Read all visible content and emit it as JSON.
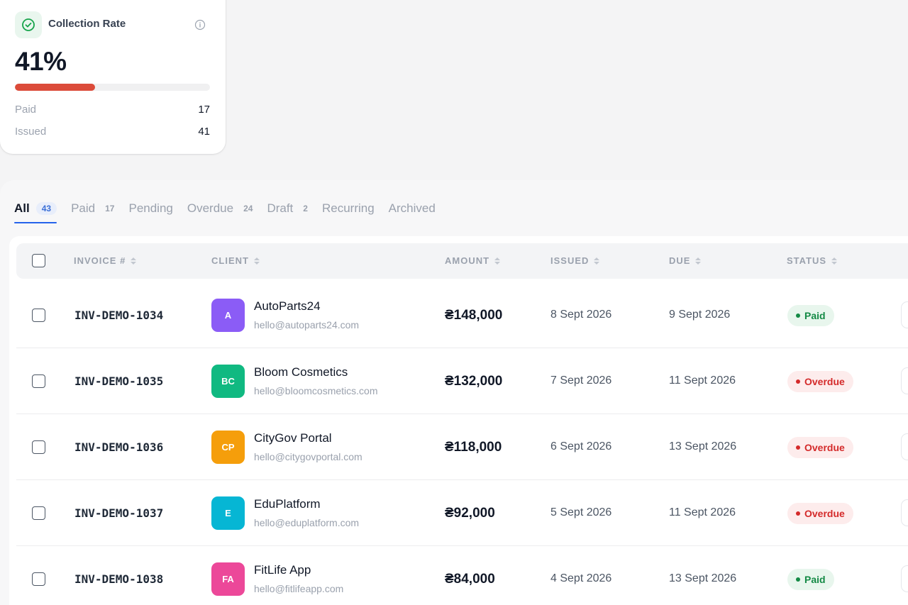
{
  "stat_card": {
    "title": "Collection Rate",
    "value": "41%",
    "progress_percent": 41,
    "rows": [
      {
        "label": "Paid",
        "value": "17"
      },
      {
        "label": "Issued",
        "value": "41"
      }
    ],
    "accent_color": "#dc4b3a"
  },
  "tabs": [
    {
      "label": "All",
      "count": "43",
      "active": true
    },
    {
      "label": "Paid",
      "count": "17"
    },
    {
      "label": "Pending",
      "count": ""
    },
    {
      "label": "Overdue",
      "count": "24"
    },
    {
      "label": "Draft",
      "count": "2"
    },
    {
      "label": "Recurring",
      "count": ""
    },
    {
      "label": "Archived",
      "count": ""
    }
  ],
  "table": {
    "headers": {
      "invoice": "INVOICE #",
      "client": "CLIENT",
      "amount": "AMOUNT",
      "issued": "ISSUED",
      "due": "DUE",
      "status": "STATUS"
    },
    "rows": [
      {
        "invoice": "INV-DEMO-1034",
        "initials": "A",
        "avatar_color": "#8b5cf6",
        "client": "AutoParts24",
        "email": "hello@autoparts24.com",
        "amount": "₴148,000",
        "issued": "8 Sept 2026",
        "due": "9 Sept 2026",
        "status": "Paid",
        "status_kind": "paid"
      },
      {
        "invoice": "INV-DEMO-1035",
        "initials": "BC",
        "avatar_color": "#10b981",
        "client": "Bloom Cosmetics",
        "email": "hello@bloomcosmetics.com",
        "amount": "₴132,000",
        "issued": "7 Sept 2026",
        "due": "11 Sept 2026",
        "status": "Overdue",
        "status_kind": "overdue"
      },
      {
        "invoice": "INV-DEMO-1036",
        "initials": "CP",
        "avatar_color": "#f59e0b",
        "client": "CityGov Portal",
        "email": "hello@citygovportal.com",
        "amount": "₴118,000",
        "issued": "6 Sept 2026",
        "due": "13 Sept 2026",
        "status": "Overdue",
        "status_kind": "overdue"
      },
      {
        "invoice": "INV-DEMO-1037",
        "initials": "E",
        "avatar_color": "#06b6d4",
        "client": "EduPlatform",
        "email": "hello@eduplatform.com",
        "amount": "₴92,000",
        "issued": "5 Sept 2026",
        "due": "11 Sept 2026",
        "status": "Overdue",
        "status_kind": "overdue"
      },
      {
        "invoice": "INV-DEMO-1038",
        "initials": "FA",
        "avatar_color": "#ec4899",
        "client": "FitLife App",
        "email": "hello@fitlifeapp.com",
        "amount": "₴84,000",
        "issued": "4 Sept 2026",
        "due": "13 Sept 2026",
        "status": "Paid",
        "status_kind": "paid"
      }
    ]
  }
}
